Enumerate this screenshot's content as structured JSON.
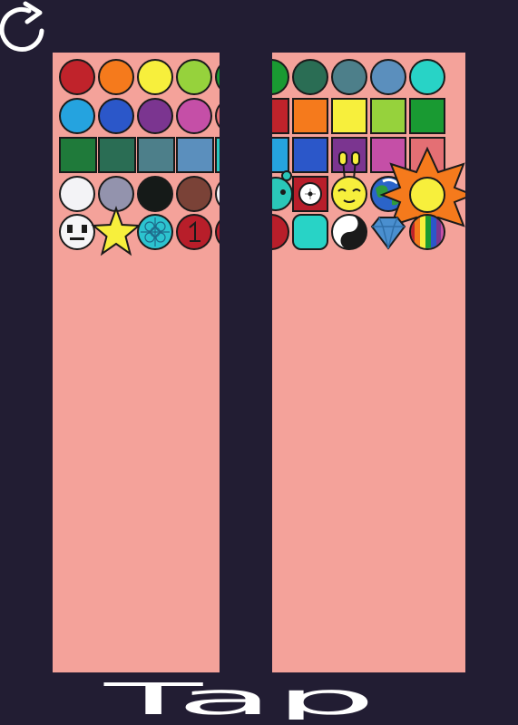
{
  "game": {
    "title": "Tap",
    "reset_icon": "rotate-arrow-icon"
  },
  "colors": {
    "background": "#221d33",
    "panel": "#f4a29a",
    "outline": "#1a1a1a"
  },
  "left_panel": {
    "row1_circles": [
      "#c0232b",
      "#f57a1c",
      "#f7ef3c",
      "#96d23c",
      "#199a32"
    ],
    "row2_circles": [
      "#25a3df",
      "#2b57c9",
      "#7b3590",
      "#c54fa7",
      "#e46f74"
    ],
    "row3_squares": [
      "#1f7a3a",
      "#2a6d54",
      "#4d7f8a",
      "#5b8fbd",
      "#28c9c0"
    ],
    "row4_circles": [
      "#f3f3f6",
      "#9393ad",
      "#151a18",
      "#7a4237",
      "#f3f3f6"
    ],
    "row5_items": [
      "robot-face-icon",
      "star-icon",
      "cyan-pattern-icon",
      "red-one-icon",
      "red-piece-icon"
    ]
  },
  "right_panel": {
    "row1_circles": [
      "#199a32",
      "#2a6d54",
      "#4d7f8a",
      "#5b8fbd",
      "#28d3c6"
    ],
    "row2_squares": [
      "#c0232b",
      "#f57a1c",
      "#f7ef3c",
      "#96d23c",
      "#199a32"
    ],
    "row3_squares": [
      "#25a3df",
      "#2b57c9",
      "#7b3590",
      "#c54fa7",
      "#e46f74"
    ],
    "row4_items": [
      "teal-creature-icon",
      "red-target-icon",
      "yellow-bug-icon",
      "earth-icon",
      "sun-star-icon"
    ],
    "row5_items": [
      "red-piece-icon",
      "teal-rounded-square-icon",
      "yin-yang-icon",
      "diamond-icon",
      "rainbow-ball-icon"
    ]
  }
}
